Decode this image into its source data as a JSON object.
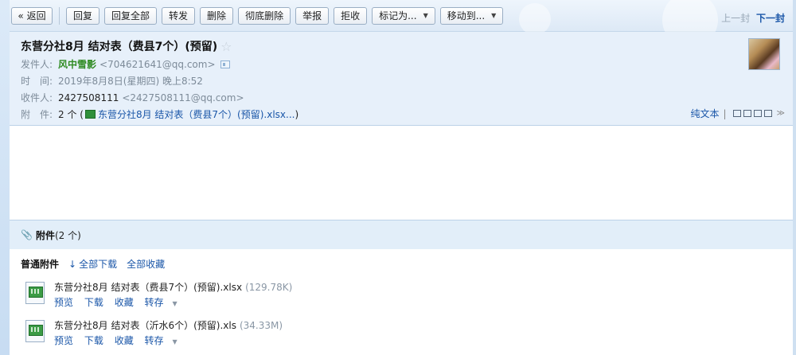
{
  "toolbar": {
    "back": "« 返回",
    "reply": "回复",
    "reply_all": "回复全部",
    "forward": "转发",
    "delete": "删除",
    "delete_permanent": "彻底删除",
    "report": "举报",
    "reject": "拒收",
    "mark_as": "标记为...",
    "move_to": "移动到...",
    "caret": "▼",
    "prev": "上一封",
    "next": "下一封"
  },
  "header": {
    "subject": "东营分社8月 结对表（费县7个）(预留)",
    "star": "☆",
    "sender_label": "发件人:",
    "sender_name": "风中雪影",
    "sender_addr": "<704621641@qq.com>",
    "time_label": "时　间:",
    "time_value": "2019年8月8日(星期四) 晚上8:52",
    "recipient_label": "收件人:",
    "recipient_name": "2427508111",
    "recipient_addr": "<2427508111@qq.com>",
    "attach_label": "附　件:",
    "attach_count": "2 个 (",
    "attach_link": "东营分社8月 结对表（费县7个）(预留).xlsx...",
    "attach_close": ")",
    "plain_text": "纯文本",
    "pipe": "|",
    "more": "≫"
  },
  "attachments": {
    "title": "附件",
    "count": "(2 个)",
    "type_label": "普通附件",
    "download_all_arrow": "↓",
    "download_all": "全部下载",
    "collect_all": "全部收藏",
    "files": [
      {
        "name": "东营分社8月 结对表（费县7个）(预留).xlsx",
        "size": "(129.78K)",
        "preview": "预览",
        "download": "下载",
        "collect": "收藏",
        "save": "转存"
      },
      {
        "name": "东营分社8月 结对表（沂水6个）(预留).xls",
        "size": "(34.33M)",
        "preview": "预览",
        "download": "下载",
        "collect": "收藏",
        "save": "转存"
      }
    ]
  }
}
